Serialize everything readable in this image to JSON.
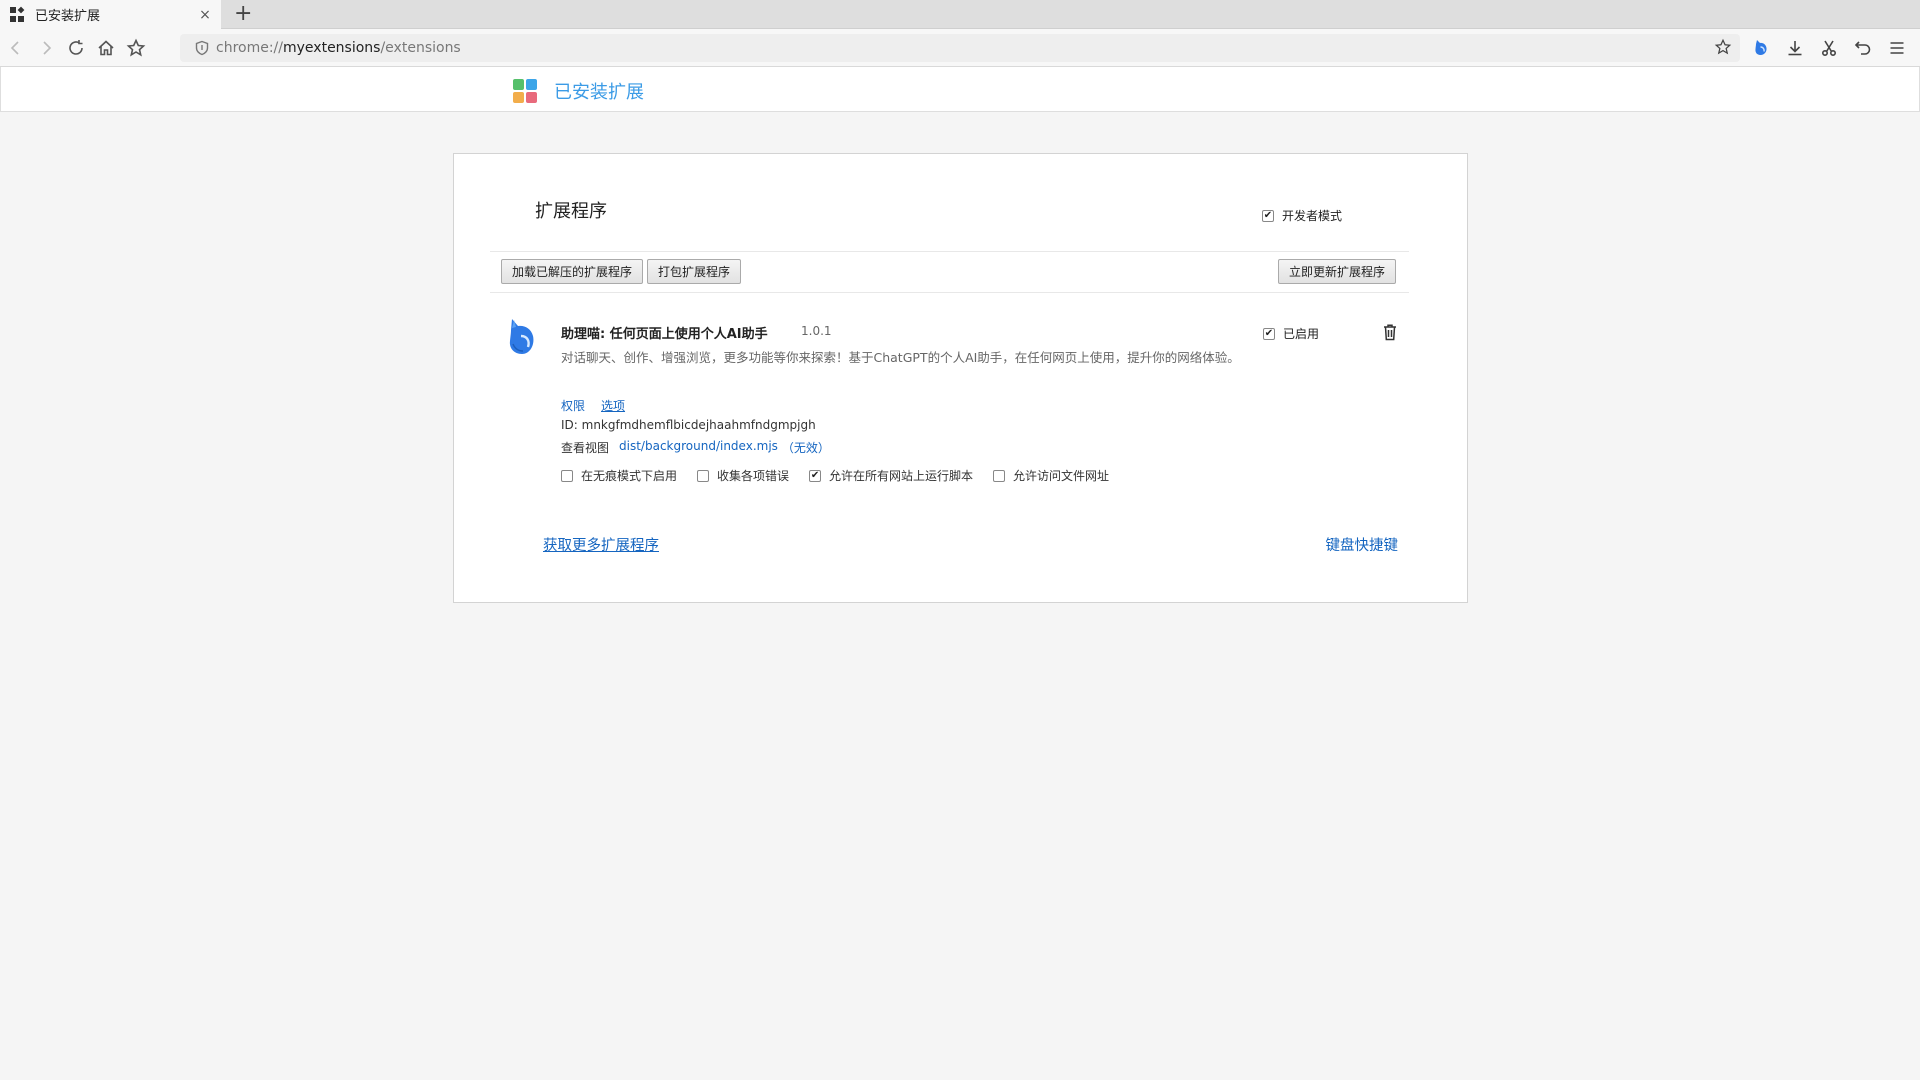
{
  "browser": {
    "tab": {
      "title": "已安装扩展",
      "close": "×"
    },
    "new_tab": "+",
    "url": {
      "scheme": "chrome://",
      "host": "myextensions",
      "path": "/extensions"
    }
  },
  "header": {
    "title": "已安装扩展",
    "logo_colors": [
      "#55c06b",
      "#3ca5e8",
      "#f2ad4b",
      "#e86a7c"
    ]
  },
  "extensions_page": {
    "title": "扩展程序",
    "developer_mode": {
      "label": "开发者模式",
      "checked": true
    },
    "buttons": {
      "load_unpacked": "加载已解压的扩展程序",
      "pack": "打包扩展程序",
      "update_now": "立即更新扩展程序"
    },
    "extension": {
      "name": "助理喵: 任何页面上使用个人AI助手",
      "version": "1.0.1",
      "description": "对话聊天、创作、增强浏览，更多功能等你来探索！基于ChatGPT的个人AI助手，在任何网页上使用，提升你的网络体验。",
      "links": {
        "permissions": "权限",
        "options": "选项"
      },
      "id_label": "ID: mnkgfmdhemflbicdejhaahmfndgmpjgh",
      "views_label": "查看视图",
      "view_link": "dist/background/index.mjs",
      "view_status": "（无效）",
      "enabled": {
        "label": "已启用",
        "checked": true
      },
      "options_checks": [
        {
          "label": "在无痕模式下启用",
          "checked": false
        },
        {
          "label": "收集各项错误",
          "checked": false
        },
        {
          "label": "允许在所有网站上运行脚本",
          "checked": true
        },
        {
          "label": "允许访问文件网址",
          "checked": false
        }
      ],
      "icon": "cat-icon"
    },
    "footer": {
      "get_more": "获取更多扩展程序",
      "keyboard_shortcuts": "键盘快捷键"
    }
  },
  "colors": {
    "link": "#1565c0",
    "header_title": "#3b9be6",
    "page_bg": "#f5f5f5"
  }
}
